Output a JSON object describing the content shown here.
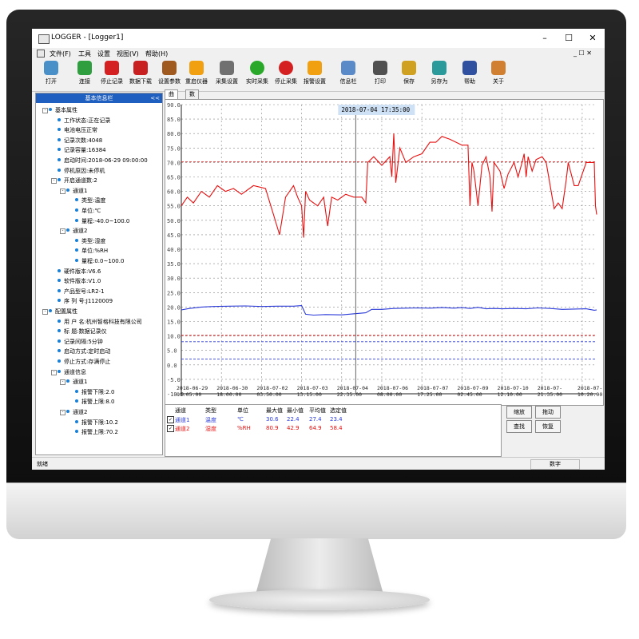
{
  "window": {
    "title": "LOGGER - [Logger1]",
    "minimize": "–",
    "maximize": "☐",
    "close": "✕"
  },
  "menu": {
    "items": [
      "文件(F)",
      "工具",
      "设置",
      "视图(V)",
      "帮助(H)"
    ],
    "mdi_controls": "_ ☐ ✕"
  },
  "toolbar": {
    "buttons": [
      {
        "label": "打开",
        "icon": "open-folder-icon",
        "color": "#4a90c8"
      },
      {
        "label": "连接",
        "icon": "connect-icon",
        "color": "#2e9e3f"
      },
      {
        "label": "停止记录",
        "icon": "stop-record-icon",
        "color": "#d42020"
      },
      {
        "label": "数据下载",
        "icon": "download-icon",
        "color": "#c82020"
      },
      {
        "label": "设置参数",
        "icon": "tools-icon",
        "color": "#a05a20"
      },
      {
        "label": "重启仪器",
        "icon": "restart-icon",
        "color": "#f0a010"
      },
      {
        "label": "采集设置",
        "icon": "gear-icon",
        "color": "#707070"
      },
      {
        "label": "实时采集",
        "icon": "plus-circle-icon",
        "color": "#2aa82a"
      },
      {
        "label": "停止采集",
        "icon": "minus-circle-icon",
        "color": "#d42020"
      },
      {
        "label": "报警设置",
        "icon": "alert-icon",
        "color": "#f0a010"
      },
      {
        "label": "信息栏",
        "icon": "info-panel-icon",
        "color": "#5a8ac8"
      },
      {
        "label": "打印",
        "icon": "printer-icon",
        "color": "#505050"
      },
      {
        "label": "保存",
        "icon": "save-icon",
        "color": "#d0a020"
      },
      {
        "label": "另存为",
        "icon": "save-as-icon",
        "color": "#2a9a9a"
      },
      {
        "label": "帮助",
        "icon": "help-book-icon",
        "color": "#3050a0"
      },
      {
        "label": "关于",
        "icon": "about-person-icon",
        "color": "#d08030"
      }
    ]
  },
  "sidebar": {
    "title": "基本信息栏",
    "collapse": "<<",
    "tree": [
      {
        "text": "基本属性",
        "level": 0,
        "exp": "-"
      },
      {
        "text": "工作状态:正在记录",
        "level": 1
      },
      {
        "text": "电池电压正常",
        "level": 1
      },
      {
        "text": "记录次数:4048",
        "level": 1
      },
      {
        "text": "记录容量:16384",
        "level": 1
      },
      {
        "text": "启动时间:2018-06-29 09:00:00",
        "level": 1
      },
      {
        "text": "停机原因:未停机",
        "level": 1
      },
      {
        "text": "开启通道数:2",
        "level": 1,
        "exp": "-"
      },
      {
        "text": "通道1",
        "level": 2,
        "exp": "-"
      },
      {
        "text": "类型:温度",
        "level": 3
      },
      {
        "text": "单位:℃",
        "level": 3
      },
      {
        "text": "量程:-40.0~100.0",
        "level": 3
      },
      {
        "text": "通道2",
        "level": 2,
        "exp": "-"
      },
      {
        "text": "类型:湿度",
        "level": 3
      },
      {
        "text": "单位:%RH",
        "level": 3
      },
      {
        "text": "量程:0.0~100.0",
        "level": 3
      },
      {
        "text": "硬件版本:V6.6",
        "level": 1
      },
      {
        "text": "软件版本:V1.0",
        "level": 1
      },
      {
        "text": "产品型号:LR2-1",
        "level": 1
      },
      {
        "text": "序 列 号:J1120009",
        "level": 1
      },
      {
        "text": "配置属性",
        "level": 0,
        "exp": "-"
      },
      {
        "text": "用 户 名:杭州智格科技有限公司",
        "level": 1
      },
      {
        "text": "标  题:数据记录仪",
        "level": 1
      },
      {
        "text": "记录间隔:5分钟",
        "level": 1
      },
      {
        "text": "启动方式:定时启动",
        "level": 1
      },
      {
        "text": "停止方式:存满停止",
        "level": 1
      },
      {
        "text": "通道信息",
        "level": 1,
        "exp": "-"
      },
      {
        "text": "通道1",
        "level": 2,
        "exp": "-"
      },
      {
        "text": "报警下限:2.0",
        "level": 3
      },
      {
        "text": "报警上限:8.0",
        "level": 3
      },
      {
        "text": "通道2",
        "level": 2,
        "exp": "-"
      },
      {
        "text": "报警下限:10.2",
        "level": 3
      },
      {
        "text": "报警上限:70.2",
        "level": 3
      }
    ]
  },
  "tabs": [
    "曲线",
    "数据"
  ],
  "chart_data": {
    "type": "line",
    "cursor_label": "2018-07-04 17:35:00",
    "cursor_x": 4.35,
    "ylim": [
      -10,
      90
    ],
    "yticks": [
      "-10.0",
      "-5.0",
      "0.0",
      "5.0",
      "10.0",
      "15.0",
      "20.0",
      "25.0",
      "30.0",
      "35.0",
      "40.0",
      "45.0",
      "50.0",
      "55.0",
      "60.0",
      "65.0",
      "70.0",
      "75.0",
      "80.0",
      "85.0",
      "90.0"
    ],
    "xlim": [
      0,
      10.36
    ],
    "xticks": [
      {
        "x": 0,
        "date": "2018-06-29",
        "time": "09:05:00"
      },
      {
        "x": 1,
        "date": "2018-06-30",
        "time": "18:00:00"
      },
      {
        "x": 2,
        "date": "2018-07-02",
        "time": "03:50:00"
      },
      {
        "x": 3,
        "date": "2018-07-03",
        "time": "13:15:00"
      },
      {
        "x": 4,
        "date": "2018-07-04",
        "time": "22:35:00"
      },
      {
        "x": 5,
        "date": "2018-07-06",
        "time": "08:00:00"
      },
      {
        "x": 6,
        "date": "2018-07-07",
        "time": "17:25:00"
      },
      {
        "x": 7,
        "date": "2018-07-09",
        "time": "02:45:00"
      },
      {
        "x": 8,
        "date": "2018-07-10",
        "time": "12:10:00"
      },
      {
        "x": 9,
        "date": "2018-07-",
        "time": "21:35:00"
      },
      {
        "x": 10,
        "date": "2018-07-",
        "time": "10:20:00"
      }
    ],
    "thresholds": [
      {
        "value": 70.2,
        "color": "#d42020"
      },
      {
        "value": 10.2,
        "color": "#d42020"
      },
      {
        "value": 8.0,
        "color": "#2a3ad8"
      },
      {
        "value": 2.0,
        "color": "#2a3ad8"
      }
    ],
    "series": [
      {
        "name": "通道2",
        "color": "#e81010",
        "points": [
          [
            0,
            55
          ],
          [
            0.15,
            58
          ],
          [
            0.3,
            56
          ],
          [
            0.5,
            60
          ],
          [
            0.7,
            58
          ],
          [
            0.9,
            62
          ],
          [
            1.1,
            60
          ],
          [
            1.3,
            61
          ],
          [
            1.5,
            59
          ],
          [
            1.8,
            62
          ],
          [
            2.1,
            61
          ],
          [
            2.3,
            52
          ],
          [
            2.45,
            45
          ],
          [
            2.6,
            58
          ],
          [
            2.8,
            62
          ],
          [
            2.9,
            58
          ],
          [
            3.0,
            55
          ],
          [
            3.05,
            44
          ],
          [
            3.1,
            60
          ],
          [
            3.2,
            57
          ],
          [
            3.4,
            55
          ],
          [
            3.55,
            58
          ],
          [
            3.65,
            48
          ],
          [
            3.75,
            58
          ],
          [
            3.9,
            57
          ],
          [
            4.1,
            59
          ],
          [
            4.3,
            58
          ],
          [
            4.5,
            58
          ],
          [
            4.6,
            56
          ],
          [
            4.65,
            70
          ],
          [
            4.8,
            72
          ],
          [
            5.0,
            69
          ],
          [
            5.2,
            72
          ],
          [
            5.25,
            65
          ],
          [
            5.3,
            80
          ],
          [
            5.35,
            63
          ],
          [
            5.45,
            75
          ],
          [
            5.6,
            70
          ],
          [
            5.8,
            72
          ],
          [
            6.0,
            73
          ],
          [
            6.2,
            77
          ],
          [
            6.35,
            77
          ],
          [
            6.5,
            79
          ],
          [
            6.7,
            78
          ],
          [
            7.0,
            76
          ],
          [
            7.15,
            76
          ],
          [
            7.2,
            55
          ],
          [
            7.25,
            70
          ],
          [
            7.3,
            67
          ],
          [
            7.4,
            55
          ],
          [
            7.5,
            69
          ],
          [
            7.6,
            72
          ],
          [
            7.7,
            65
          ],
          [
            7.75,
            53
          ],
          [
            7.8,
            70
          ],
          [
            7.95,
            67
          ],
          [
            8.05,
            61
          ],
          [
            8.15,
            66
          ],
          [
            8.3,
            70
          ],
          [
            8.4,
            65
          ],
          [
            8.5,
            70
          ],
          [
            8.55,
            73
          ],
          [
            8.6,
            65
          ],
          [
            8.65,
            72
          ],
          [
            8.75,
            67
          ],
          [
            8.85,
            71
          ],
          [
            9.0,
            72
          ],
          [
            9.1,
            70
          ],
          [
            9.2,
            62
          ],
          [
            9.3,
            54
          ],
          [
            9.4,
            56
          ],
          [
            9.5,
            54
          ],
          [
            9.6,
            64
          ],
          [
            9.65,
            70
          ],
          [
            9.8,
            62
          ],
          [
            9.9,
            62
          ],
          [
            10.1,
            70
          ],
          [
            10.3,
            70
          ],
          [
            10.33,
            55
          ],
          [
            10.36,
            52
          ]
        ]
      },
      {
        "name": "通道1",
        "color": "#2a3ad8",
        "points": [
          [
            0,
            19
          ],
          [
            0.2,
            19.5
          ],
          [
            0.5,
            20
          ],
          [
            0.8,
            20.2
          ],
          [
            1.2,
            20.3
          ],
          [
            1.6,
            20.4
          ],
          [
            2.0,
            20.2
          ],
          [
            2.4,
            20.3
          ],
          [
            2.8,
            20.3
          ],
          [
            3.0,
            20.5
          ],
          [
            3.1,
            17.5
          ],
          [
            3.3,
            17.2
          ],
          [
            3.6,
            17.4
          ],
          [
            4.0,
            17.3
          ],
          [
            4.4,
            17.8
          ],
          [
            4.6,
            18
          ],
          [
            4.75,
            19.2
          ],
          [
            5.0,
            19.2
          ],
          [
            5.3,
            19.5
          ],
          [
            5.6,
            19.6
          ],
          [
            5.9,
            19.7
          ],
          [
            6.2,
            19.6
          ],
          [
            6.5,
            19.8
          ],
          [
            6.8,
            19.6
          ],
          [
            7.0,
            19.8
          ],
          [
            7.2,
            19.5
          ],
          [
            7.4,
            19.9
          ],
          [
            7.6,
            19.4
          ],
          [
            7.8,
            19.5
          ],
          [
            8.0,
            19.4
          ],
          [
            8.3,
            19.5
          ],
          [
            8.6,
            19.4
          ],
          [
            8.9,
            19.7
          ],
          [
            9.2,
            19.5
          ],
          [
            9.5,
            19.2
          ],
          [
            9.8,
            19.3
          ],
          [
            10.1,
            19.4
          ],
          [
            10.3,
            18.9
          ],
          [
            10.36,
            19.0
          ]
        ]
      }
    ]
  },
  "table": {
    "headers": [
      "通道",
      "类型",
      "单位",
      "最大值",
      "最小值",
      "平均值",
      "选定值"
    ],
    "rows": [
      {
        "checked": "✓",
        "channel": "通道1",
        "type": "温度",
        "unit": "℃",
        "max": "30.6",
        "min": "22.4",
        "avg": "27.4",
        "sel": "23.4",
        "color": "#2a3ad8"
      },
      {
        "checked": "✓",
        "channel": "通道2",
        "type": "湿度",
        "unit": "%RH",
        "max": "80.9",
        "min": "42.9",
        "avg": "64.9",
        "sel": "58.4",
        "color": "#e81010"
      }
    ]
  },
  "side_buttons": [
    "缩放",
    "拖动",
    "查找",
    "恢复"
  ],
  "status": {
    "left": "就绪",
    "mid": "数字"
  }
}
